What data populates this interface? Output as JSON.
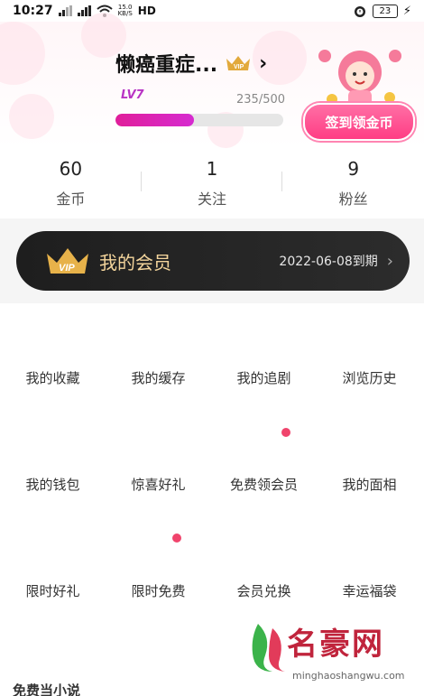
{
  "status_bar": {
    "time": "10:27",
    "net_speed_top": "15.0",
    "net_speed_bottom": "KB/S",
    "network_type": "HD",
    "battery": "23"
  },
  "profile": {
    "username": "懒癌重症...",
    "vip_badge_icon": "vip-crown-icon",
    "level": "LV7",
    "exp_text": "235/500",
    "exp_fraction": 0.47,
    "signin_label": "签到领金币"
  },
  "stats": [
    {
      "value": "60",
      "label": "金币"
    },
    {
      "value": "1",
      "label": "关注"
    },
    {
      "value": "9",
      "label": "粉丝"
    }
  ],
  "vip": {
    "title": "我的会员",
    "expiry": "2022-06-08到期"
  },
  "grid_items": [
    {
      "label": "我的收藏"
    },
    {
      "label": "我的缓存"
    },
    {
      "label": "我的追剧"
    },
    {
      "label": "浏览历史"
    },
    {
      "label": "我的钱包"
    },
    {
      "label": "惊喜好礼"
    },
    {
      "label": "免费领会员"
    },
    {
      "label": "我的面相"
    },
    {
      "label": "限时好礼"
    },
    {
      "label": "限时免费"
    },
    {
      "label": "会员兑换"
    },
    {
      "label": "幸运福袋"
    }
  ],
  "bottom_section_title": "免费当小说",
  "watermark": {
    "name": "名豪网",
    "url": "minghaoshangwu.com"
  },
  "colors": {
    "accent_pink": "#ff3d84",
    "progress": "#e01e9a",
    "vip_gold": "#f4d59c",
    "red_dot": "#f0446c"
  }
}
